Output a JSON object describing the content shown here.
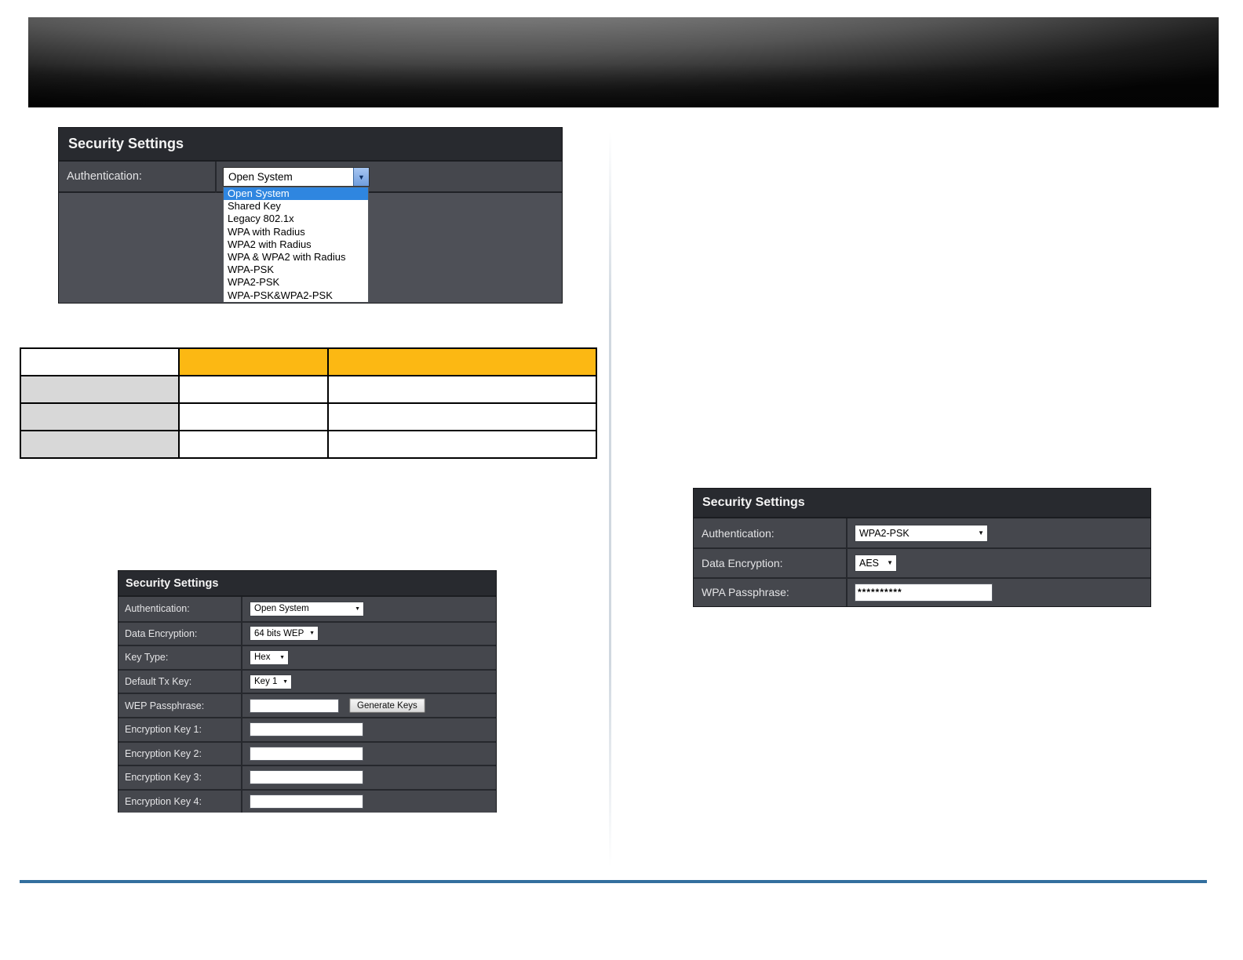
{
  "panel_open_dropdown": {
    "title": "Security Settings",
    "auth_label": "Authentication:",
    "selected_option": "Open System",
    "dropdown_options": [
      "Open System",
      "Shared Key",
      "Legacy 802.1x",
      "WPA with Radius",
      "WPA2 with Radius",
      "WPA & WPA2 with Radius",
      "WPA-PSK",
      "WPA2-PSK",
      "WPA-PSK&WPA2-PSK"
    ]
  },
  "comparison_table": {
    "header": [
      "",
      "",
      ""
    ],
    "rows": [
      [
        "",
        "",
        ""
      ],
      [
        "",
        "",
        ""
      ],
      [
        "",
        "",
        ""
      ]
    ]
  },
  "panel_wep": {
    "title": "Security Settings",
    "rows": [
      {
        "label": "Authentication:",
        "value": "Open System"
      },
      {
        "label": "Data Encryption:",
        "value": "64 bits WEP"
      },
      {
        "label": "Key Type:",
        "value": "Hex"
      },
      {
        "label": "Default Tx Key:",
        "value": "Key 1"
      },
      {
        "label": "WEP Passphrase:",
        "value": "",
        "button": "Generate Keys"
      },
      {
        "label": "Encryption Key 1:",
        "value": ""
      },
      {
        "label": "Encryption Key 2:",
        "value": ""
      },
      {
        "label": "Encryption Key 3:",
        "value": ""
      },
      {
        "label": "Encryption Key 4:",
        "value": ""
      }
    ]
  },
  "panel_wpa2": {
    "title": "Security Settings",
    "rows": [
      {
        "label": "Authentication:",
        "value": "WPA2-PSK"
      },
      {
        "label": "Data Encryption:",
        "value": "AES"
      },
      {
        "label": "WPA Passphrase:",
        "value": "**********"
      }
    ]
  },
  "colors": {
    "table_header_yellow": "#fcb813",
    "table_side_gray": "#d8d8d8",
    "panel_row_gray": "#45474d",
    "panel_header_dark": "#282a2f",
    "dropdown_selection_blue": "#2f86e0",
    "footer_rule_blue": "#336f9e"
  }
}
